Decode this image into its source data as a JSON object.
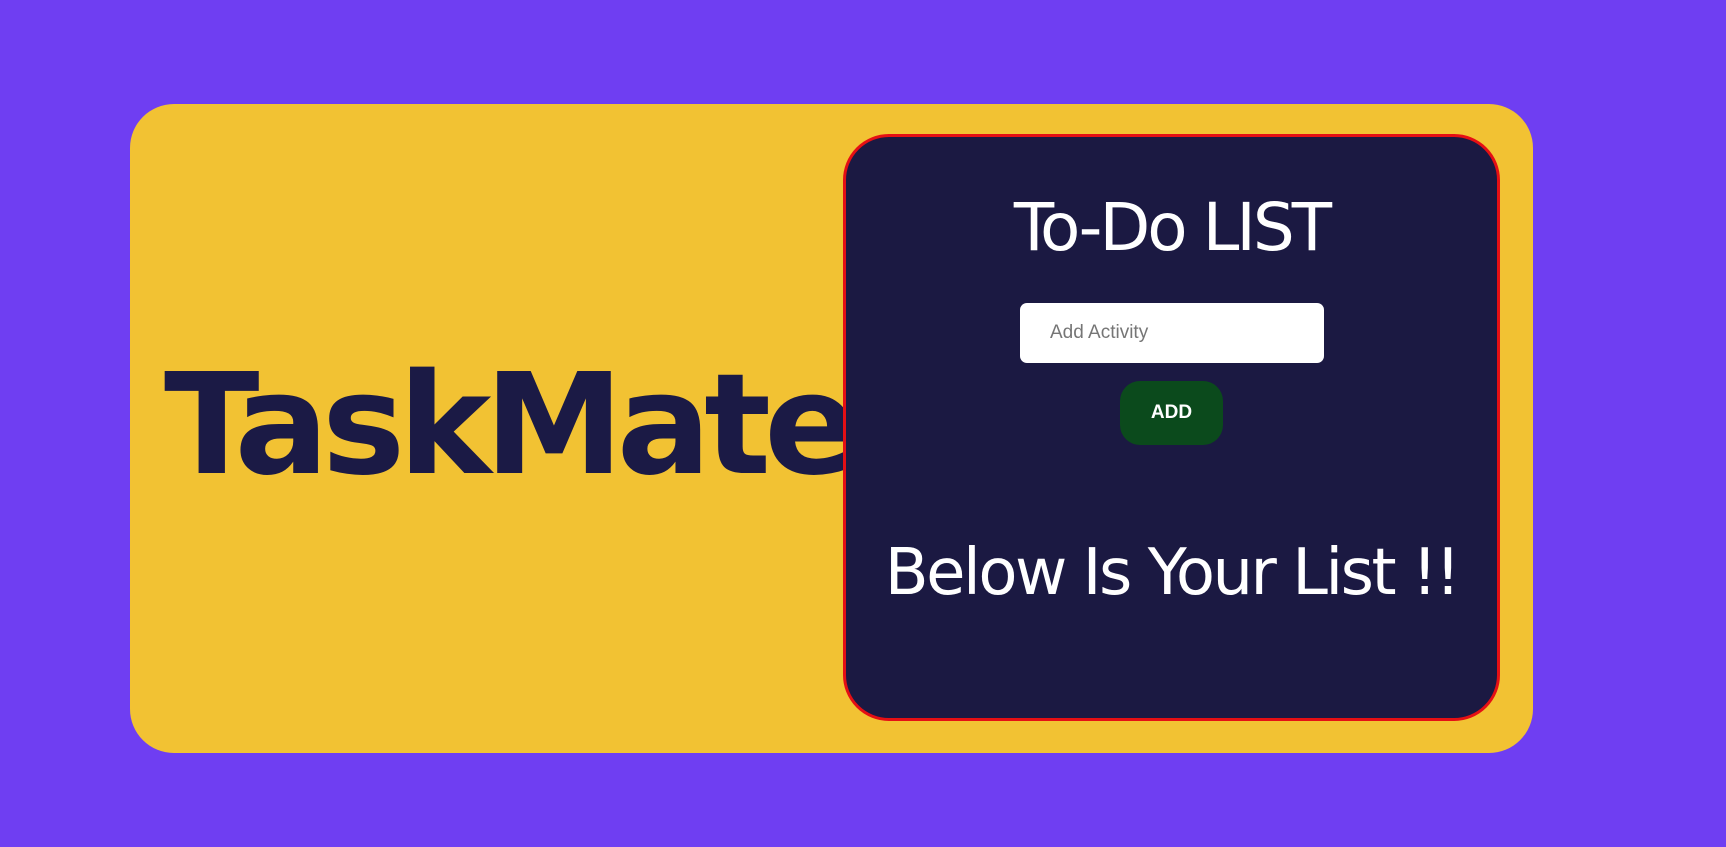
{
  "brand": {
    "title": "TaskMate"
  },
  "todo": {
    "title": "To-Do LIST",
    "input_placeholder": "Add Activity",
    "input_value": "",
    "add_label": "ADD",
    "list_heading": "Below Is Your List !!",
    "items": []
  },
  "colors": {
    "page_background": "#6f3ef2",
    "card_background": "#f2c233",
    "panel_background": "#1b1942",
    "panel_border": "#e50f14",
    "brand_text": "#1b1a45",
    "add_button": "#0b4a1c"
  }
}
